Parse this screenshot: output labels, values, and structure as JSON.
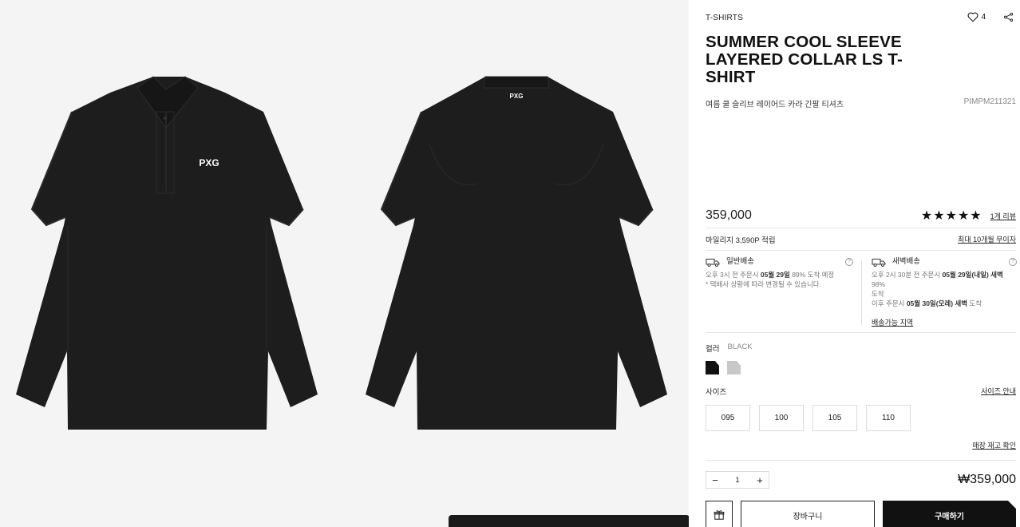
{
  "product": {
    "category": "T-SHIRTS",
    "title": "SUMMER COOL SLEEVE LAYERED COLLAR LS T-SHIRT",
    "subtitle_kr": "여름 쿨 슬리브 레이어드 카라 긴팔 티셔츠",
    "code": "PIMPM211321",
    "likes": "4",
    "price": "359,000",
    "stars": "★★★★★",
    "rating_score": 5,
    "reviews_link": "1개 리뷰",
    "brand_logo": "PXG",
    "colors": {
      "main": "#111111",
      "alt": "#c8c8c8"
    }
  },
  "mileage": {
    "text": "마일리지 3,590P 적립",
    "installment_link": "최대 10개월 무이자"
  },
  "shipping": {
    "standard": {
      "label": "일반배송",
      "line1_pre": "오후 3시 전 주문시 ",
      "line1_date": "05월 29일",
      "line1_post": " 89% 도착 예정",
      "line2": "* 택배사 상황에 따라 변경될 수 있습니다."
    },
    "dawn": {
      "label": "새벽배송",
      "line1_pre": "오후 2시 30분 전 주문시 ",
      "line1_date": "05월 29일(내일) 새벽",
      "line1_post": " 98%",
      "line1_cont": "도착",
      "line2_pre": "이후 주문시 ",
      "line2_date": "05월 30일(모레) 새벽",
      "line2_post": " 도착",
      "area_link": "배송가능 지역"
    }
  },
  "color_option": {
    "label": "컬러",
    "selected": "BLACK"
  },
  "size_option": {
    "label": "사이즈",
    "guide_link": "사이즈 안내",
    "sizes": [
      "095",
      "100",
      "105",
      "110"
    ],
    "stock_link": "매장 재고 확인"
  },
  "quantity": {
    "value": "1",
    "minus": "−",
    "plus": "+"
  },
  "total": "₩359,000",
  "buttons": {
    "cart": "장바구니",
    "buy": "구매하기"
  }
}
